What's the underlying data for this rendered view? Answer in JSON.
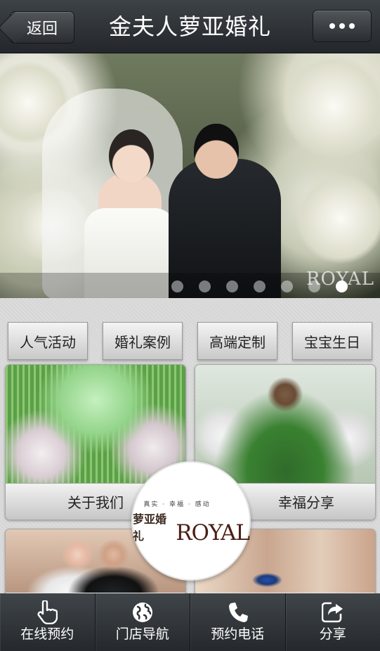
{
  "header": {
    "back_label": "返回",
    "title": "金夫人萝亚婚礼"
  },
  "banner": {
    "watermark": "ROYAL",
    "slide_count": 7,
    "active_slide": 7
  },
  "tabs": [
    {
      "label": "人气活动"
    },
    {
      "label": "婚礼案例"
    },
    {
      "label": "高端定制"
    },
    {
      "label": "宝宝生日"
    }
  ],
  "cards": {
    "about": {
      "label": "关于我们"
    },
    "share": {
      "label": "幸福分享"
    }
  },
  "logo": {
    "slogan": "真实 · 幸福 · 感动",
    "cn": "萝亚婚礼",
    "en": "ROYAL"
  },
  "bottom_nav": [
    {
      "label": "在线预约",
      "icon": "hand-pointer-icon"
    },
    {
      "label": "门店导航",
      "icon": "globe-icon"
    },
    {
      "label": "预约电话",
      "icon": "phone-icon"
    },
    {
      "label": "分享",
      "icon": "share-icon"
    }
  ],
  "colors": {
    "bar_dark": "#25292d",
    "bar_light": "#40454a",
    "logo_brown": "#4a1f14"
  }
}
